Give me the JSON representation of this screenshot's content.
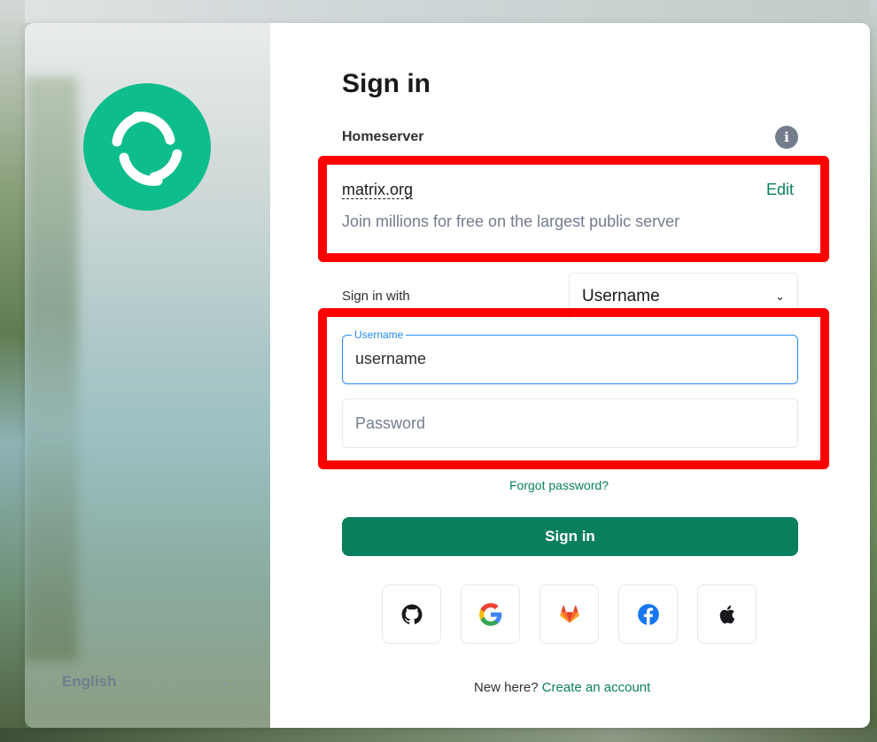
{
  "login": {
    "title": "Sign in",
    "homeserver_label": "Homeserver",
    "homeserver_name": "matrix.org",
    "homeserver_edit": "Edit",
    "homeserver_desc": "Join millions for free on the largest public server",
    "signin_with_label": "Sign in with",
    "signin_with_value": "Username",
    "username_label": "Username",
    "username_value": "username",
    "password_placeholder": "Password",
    "forgot_password": "Forgot password?",
    "signin_button": "Sign in",
    "register_prompt": "New here?",
    "register_link": "Create an account"
  },
  "sso_providers": [
    {
      "name": "github",
      "icon": "github-icon"
    },
    {
      "name": "google",
      "icon": "google-icon"
    },
    {
      "name": "gitlab",
      "icon": "gitlab-icon"
    },
    {
      "name": "facebook",
      "icon": "facebook-icon"
    },
    {
      "name": "apple",
      "icon": "apple-icon"
    }
  ],
  "language": {
    "selected": "English"
  },
  "colors": {
    "accent": "#0a7f5e",
    "brand": "#0dbd8b",
    "focus": "#238cf5",
    "highlight": "#ff0000"
  }
}
